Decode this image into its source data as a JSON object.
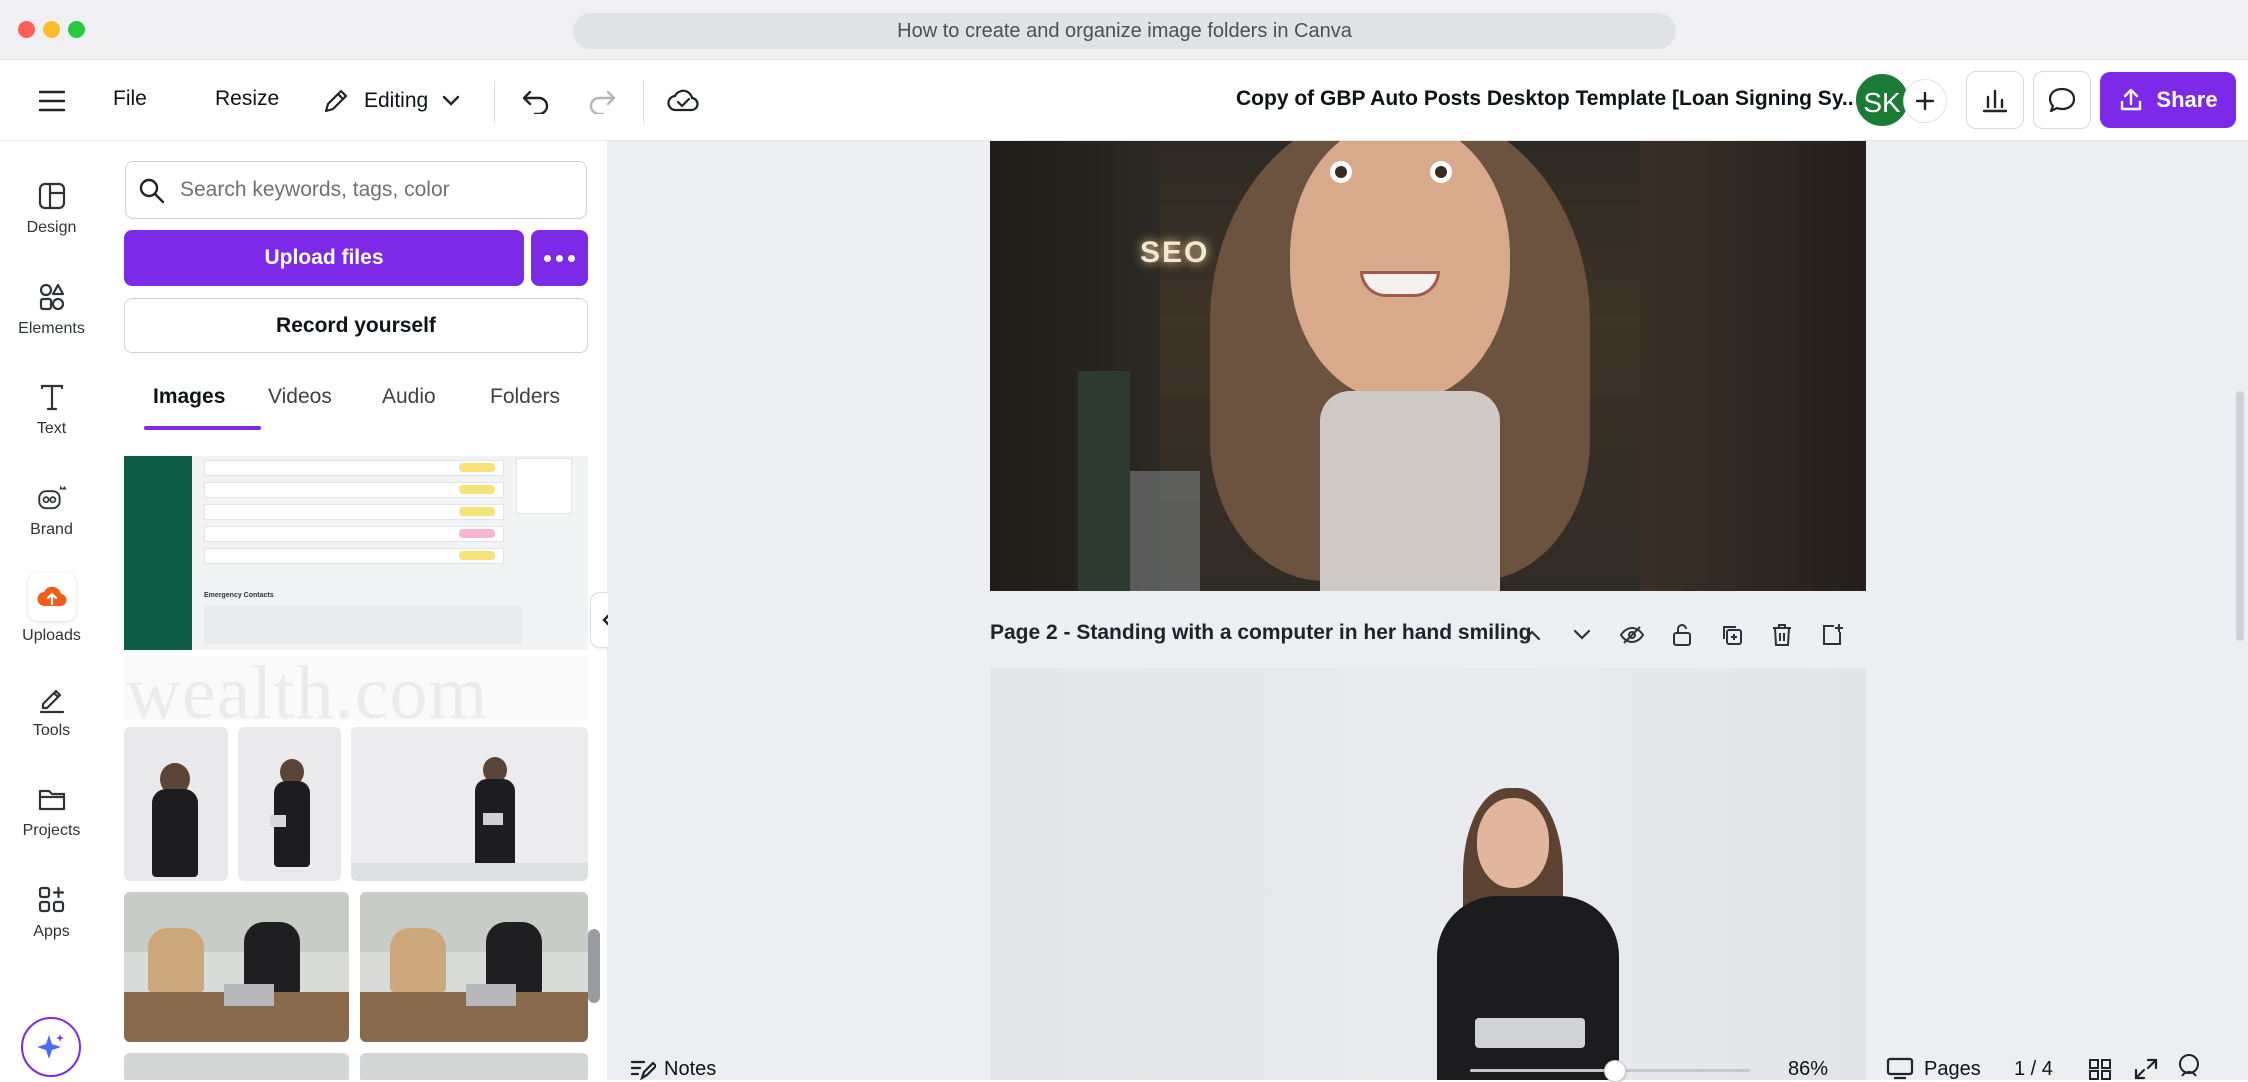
{
  "browser": {
    "url_title": "How to create and organize image folders in Canva"
  },
  "toolbar": {
    "file_label": "File",
    "resize_label": "Resize",
    "editing_label": "Editing",
    "doc_title": "Copy of GBP Auto Posts Desktop Template [Loan Signing Sy...",
    "avatar_initials": "SK",
    "share_label": "Share",
    "accent_color": "#7d2ae8"
  },
  "rail": {
    "items": [
      {
        "label": "Design",
        "icon": "design-icon"
      },
      {
        "label": "Elements",
        "icon": "elements-icon"
      },
      {
        "label": "Text",
        "icon": "text-icon"
      },
      {
        "label": "Brand",
        "icon": "brand-icon"
      },
      {
        "label": "Uploads",
        "icon": "uploads-icon"
      },
      {
        "label": "Tools",
        "icon": "tools-icon"
      },
      {
        "label": "Projects",
        "icon": "projects-icon"
      },
      {
        "label": "Apps",
        "icon": "apps-icon"
      }
    ]
  },
  "panel": {
    "search_placeholder": "Search keywords, tags, color",
    "upload_label": "Upload files",
    "record_label": "Record yourself",
    "tabs": [
      "Images",
      "Videos",
      "Audio",
      "Folders"
    ],
    "active_tab": "Images",
    "wealth_text": "wealth.com",
    "screenshot_heading": "Emergency Contacts"
  },
  "canvas": {
    "page2_label": "Page 2 - ",
    "page2_title": "Standing with a computer in her hand smiling",
    "neon_sign": "SEO"
  },
  "bottom": {
    "notes_label": "Notes",
    "zoom": "86%",
    "pages_label": "Pages",
    "page_count": "1 / 4"
  }
}
